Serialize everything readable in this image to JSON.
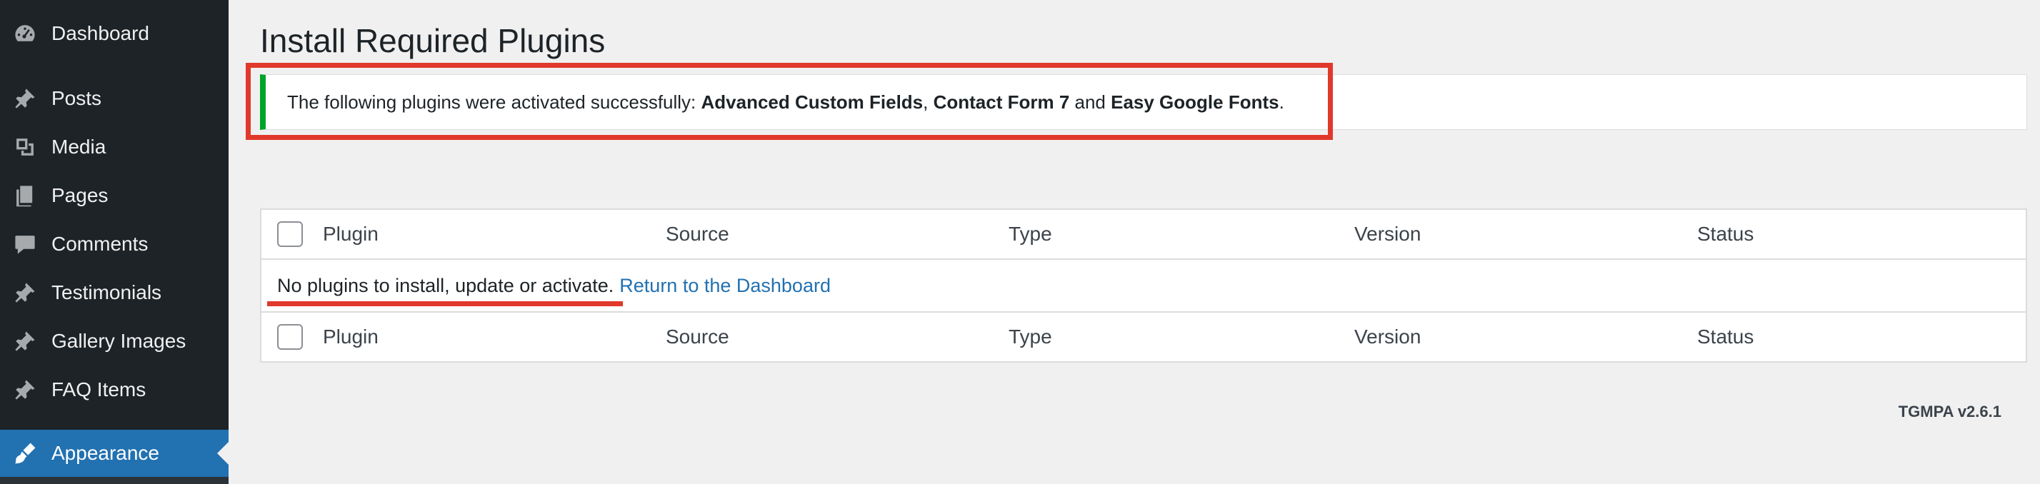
{
  "sidebar": {
    "items": [
      {
        "label": "Dashboard",
        "icon": "dashboard-icon"
      },
      {
        "label": "Posts",
        "icon": "pin-icon"
      },
      {
        "label": "Media",
        "icon": "media-icon"
      },
      {
        "label": "Pages",
        "icon": "pages-icon"
      },
      {
        "label": "Comments",
        "icon": "comments-icon"
      },
      {
        "label": "Testimonials",
        "icon": "pin-icon"
      },
      {
        "label": "Gallery Images",
        "icon": "pin-icon"
      },
      {
        "label": "FAQ Items",
        "icon": "pin-icon"
      },
      {
        "label": "Appearance",
        "icon": "appearance-icon",
        "active": true
      }
    ]
  },
  "page": {
    "title": "Install Required Plugins"
  },
  "notice": {
    "prefix": "The following plugins were activated successfully: ",
    "plugin1": "Advanced Custom Fields",
    "sep1": ", ",
    "plugin2": "Contact Form 7",
    "sep2": " and ",
    "plugin3": "Easy Google Fonts",
    "suffix": "."
  },
  "table": {
    "columns": [
      "Plugin",
      "Source",
      "Type",
      "Version",
      "Status"
    ],
    "empty_message": "No plugins to install, update or activate.",
    "return_link": "Return to the Dashboard"
  },
  "footer": {
    "version": "TGMPA v2.6.1"
  },
  "colors": {
    "sidebar_bg": "#1d2327",
    "active_bg": "#2271b1",
    "success_border": "#00a32a",
    "highlight": "#e0392b",
    "link": "#2271b1"
  }
}
